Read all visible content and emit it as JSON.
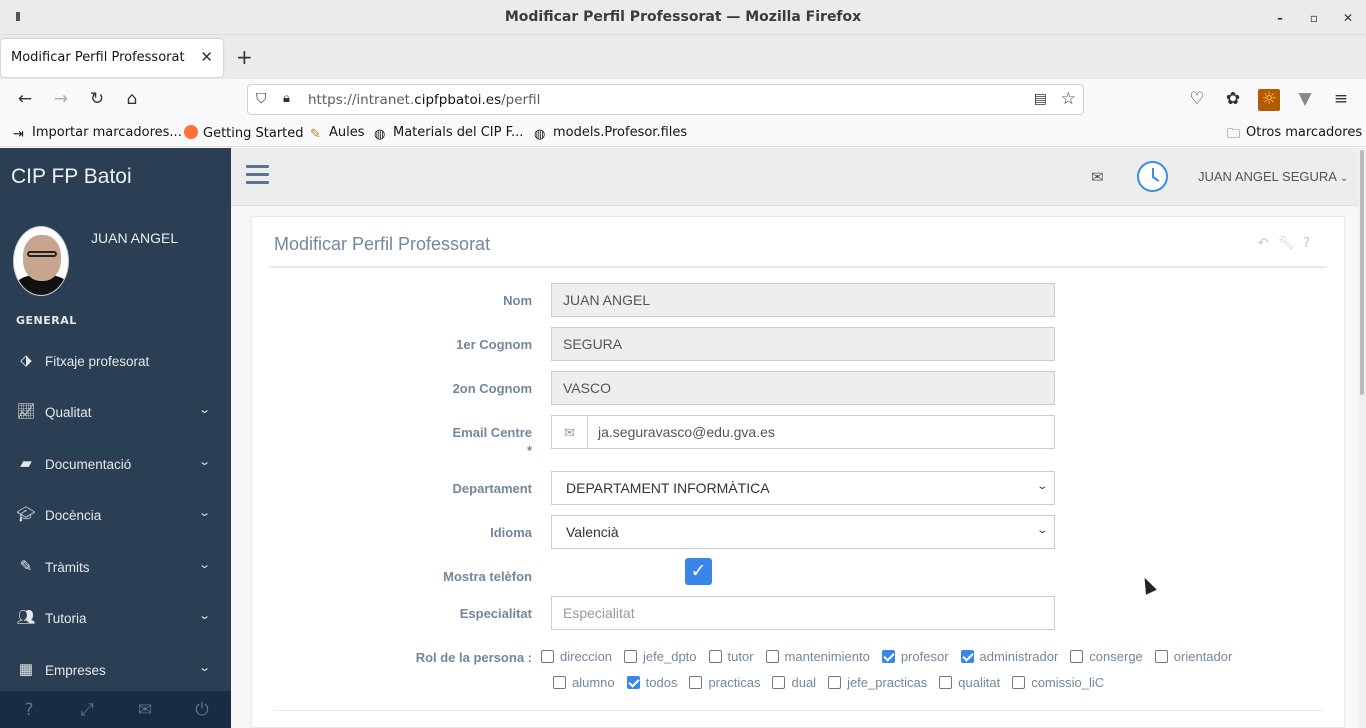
{
  "window": {
    "title": "Modificar Perfil Professorat — Mozilla Firefox"
  },
  "tabs": [
    {
      "label": "Modificar Perfil Professorat"
    }
  ],
  "url": {
    "prefix": "https://intranet.",
    "domain": "cipfpbatoi.es",
    "path": "/perfil"
  },
  "bookmarks": [
    {
      "label": "Importar marcadores...",
      "icon": "import-icon"
    },
    {
      "label": "Getting Started",
      "icon": "firefox-icon"
    },
    {
      "label": "Aules",
      "icon": "note-icon"
    },
    {
      "label": "Materials del CIP F...",
      "icon": "globe-icon"
    },
    {
      "label": "models.Profesor.files",
      "icon": "globe-icon"
    }
  ],
  "other_bookmarks": "Otros marcadores",
  "sidebar": {
    "brand": "CIP FP Batoi",
    "user_name": "JUAN ANGEL",
    "section": "GENERAL",
    "items": [
      {
        "label": "Fitxaje profesorat",
        "icon": "ticket-icon",
        "has_submenu": false
      },
      {
        "label": "Qualitat",
        "icon": "line-chart-icon",
        "has_submenu": true
      },
      {
        "label": "Documentació",
        "icon": "book-icon",
        "has_submenu": true
      },
      {
        "label": "Docència",
        "icon": "graduation-cap-icon",
        "has_submenu": true
      },
      {
        "label": "Tràmits",
        "icon": "pencil-icon",
        "has_submenu": true
      },
      {
        "label": "Tutoria",
        "icon": "users-icon",
        "has_submenu": true
      },
      {
        "label": "Empreses",
        "icon": "building-icon",
        "has_submenu": true
      }
    ],
    "footer": [
      "help-icon",
      "fullscreen-icon",
      "mail-icon",
      "power-icon"
    ]
  },
  "topnav": {
    "user": "JUAN ANGEL SEGURA"
  },
  "panel": {
    "title": "Modificar Perfil Professorat",
    "fields": {
      "nom": {
        "label": "Nom",
        "value": "JUAN ANGEL"
      },
      "cognom1": {
        "label": "1er Cognom",
        "value": "SEGURA"
      },
      "cognom2": {
        "label": "2on Cognom",
        "value": "VASCO"
      },
      "email": {
        "label": "Email Centre",
        "required_mark": "*",
        "value": "ja.seguravasco@edu.gva.es"
      },
      "departament": {
        "label": "Departament",
        "value": "DEPARTAMENT INFORMÀTICA"
      },
      "idioma": {
        "label": "Idioma",
        "value": "Valencià"
      },
      "mostra_telefon": {
        "label": "Mostra telèfon",
        "checked": true
      },
      "especialitat": {
        "label": "Especialitat",
        "placeholder": "Especialitat"
      }
    },
    "roles_label": "Rol de la persona :",
    "roles_row1": [
      {
        "name": "direccion",
        "checked": false
      },
      {
        "name": "jefe_dpto",
        "checked": false
      },
      {
        "name": "tutor",
        "checked": false
      },
      {
        "name": "mantenimiento",
        "checked": false
      },
      {
        "name": "profesor",
        "checked": true
      },
      {
        "name": "administrador",
        "checked": true
      },
      {
        "name": "conserge",
        "checked": false
      },
      {
        "name": "orientador",
        "checked": false
      }
    ],
    "roles_row2": [
      {
        "name": "alumno",
        "checked": false
      },
      {
        "name": "todos",
        "checked": true
      },
      {
        "name": "practicas",
        "checked": false
      },
      {
        "name": "dual",
        "checked": false
      },
      {
        "name": "jefe_practicas",
        "checked": false
      },
      {
        "name": "qualitat",
        "checked": false
      },
      {
        "name": "comissio_liC",
        "checked": false
      }
    ]
  },
  "colors": {
    "sidebar_bg": "#2a3f54",
    "accent": "#3a86e8",
    "label": "#73879c"
  }
}
